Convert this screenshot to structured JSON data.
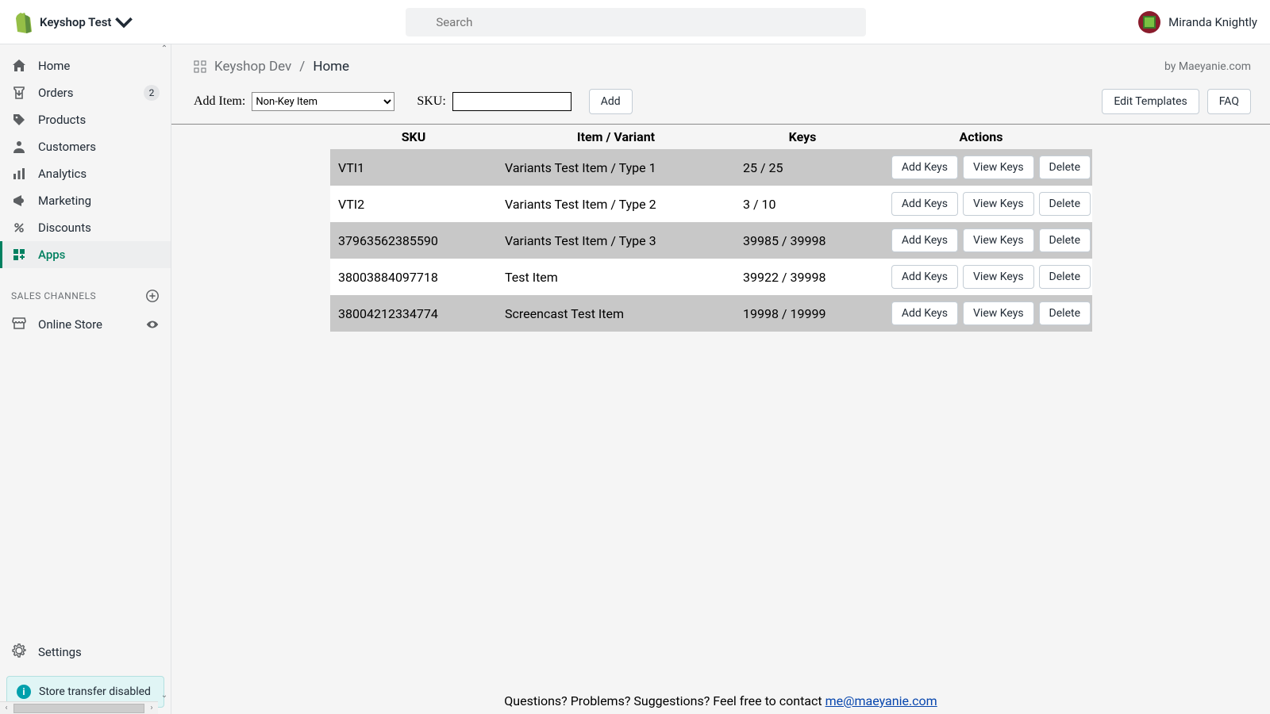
{
  "topbar": {
    "store_name": "Keyshop Test",
    "search_placeholder": "Search",
    "user_name": "Miranda Knightly"
  },
  "sidebar": {
    "items": [
      {
        "label": "Home"
      },
      {
        "label": "Orders",
        "badge": "2"
      },
      {
        "label": "Products"
      },
      {
        "label": "Customers"
      },
      {
        "label": "Analytics"
      },
      {
        "label": "Marketing"
      },
      {
        "label": "Discounts"
      },
      {
        "label": "Apps"
      }
    ],
    "channels_title": "SALES CHANNELS",
    "channel": {
      "label": "Online Store"
    },
    "settings_label": "Settings",
    "toast": "Store transfer disabled"
  },
  "breadcrumb": {
    "app": "Keyshop Dev",
    "current": "Home",
    "attribution": "by Maeyanie.com"
  },
  "toolbar": {
    "add_item_label": "Add Item:",
    "select_value": "Non-Key Item",
    "sku_label": "SKU:",
    "add_button": "Add",
    "edit_templates": "Edit Templates",
    "faq": "FAQ"
  },
  "table": {
    "headers": {
      "sku": "SKU",
      "item": "Item / Variant",
      "keys": "Keys",
      "actions": "Actions"
    },
    "buttons": {
      "add": "Add Keys",
      "view": "View Keys",
      "delete": "Delete"
    },
    "rows": [
      {
        "sku": "VTI1",
        "item": "Variants Test Item / Type 1",
        "keys": "25 / 25"
      },
      {
        "sku": "VTI2",
        "item": "Variants Test Item / Type 2",
        "keys": "3 / 10"
      },
      {
        "sku": "37963562385590",
        "item": "Variants Test Item / Type 3",
        "keys": "39985 / 39998"
      },
      {
        "sku": "38003884097718",
        "item": "Test Item",
        "keys": "39922 / 39998"
      },
      {
        "sku": "38004212334774",
        "item": "Screencast Test Item",
        "keys": "19998 / 19999"
      }
    ]
  },
  "footer": {
    "text": "Questions? Problems? Suggestions? Feel free to contact ",
    "email": "me@maeyanie.com"
  }
}
